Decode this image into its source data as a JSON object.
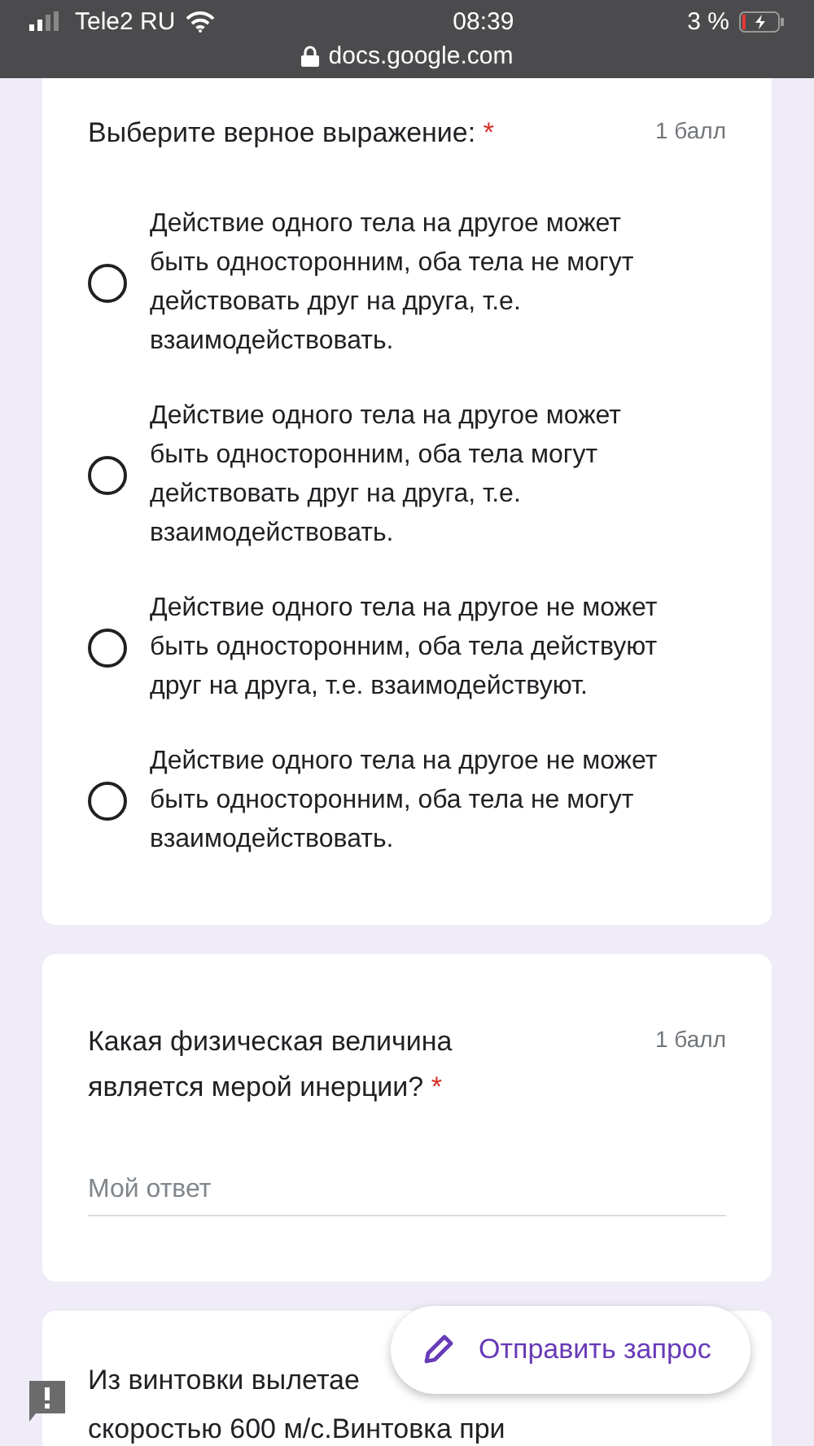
{
  "status_bar": {
    "carrier": "Tele2 RU",
    "time": "08:39",
    "battery": "3 %",
    "url": "docs.google.com"
  },
  "questions": [
    {
      "kind": "radio",
      "title": "Выберите верное выражение:",
      "required_mark": "*",
      "points": "1 балл",
      "options": [
        {
          "label": "Действие одного тела на другое может быть односторонним, оба тела не могут действовать друг на друга, т.е. взаимодействовать.",
          "selected": false
        },
        {
          "label": "Действие одного тела на другое может быть односторонним, оба тела могут действовать друг на друга, т.е. взаимодействовать.",
          "selected": false
        },
        {
          "label": "Действие одного тела на другое не может быть односторонним, оба тела действуют друг на друга, т.е. взаимодействуют.",
          "selected": false
        },
        {
          "label": "Действие одного тела на другое не может быть односторонним, оба тела не могут взаимодействовать.",
          "selected": false
        }
      ]
    },
    {
      "kind": "text",
      "title": "Какая физическая величина является мерой инерции?",
      "required_mark": "*",
      "points": "1 балл",
      "placeholder": "Мой ответ"
    },
    {
      "kind": "partial",
      "title_lines": [
        "Из винтовки вылетае",
        "скоростью 600 м/с.Винтовка при"
      ]
    }
  ],
  "fab": {
    "label": "Отправить запрос"
  }
}
